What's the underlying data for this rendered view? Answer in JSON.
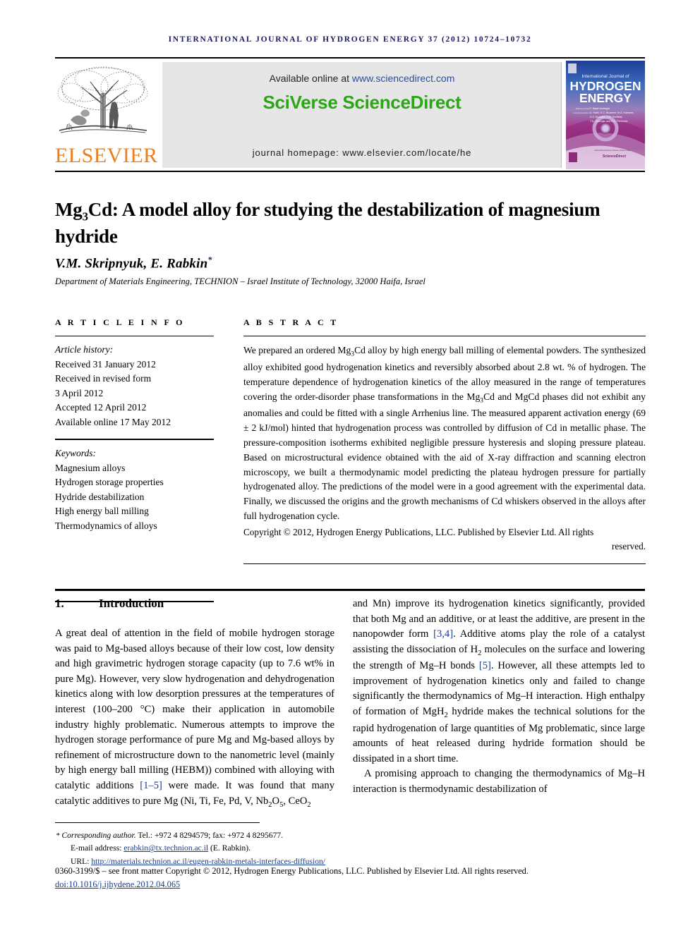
{
  "running_head": "International Journal of Hydrogen Energy 37 (2012) 10724–10732",
  "masthead": {
    "publisher_name": "ELSEVIER",
    "available_label": "Available online at ",
    "available_url": "www.sciencedirect.com",
    "sciencedirect_logo": "SciVerse ScienceDirect",
    "homepage": "journal homepage: www.elsevier.com/locate/he",
    "cover": {
      "line1": "International Journal of",
      "line2": "HYDROGEN",
      "line3": "ENERGY",
      "editor_label": "Editor-in-Chief",
      "editor_name": "T. Nejat Veziroglu",
      "assoc_label": "Associate Editors",
      "assoc_line1": "A. Hariri, E.C. Bruckner, M.A. Kaesche,",
      "assoc_line2": "N.Z. Muradov, J.W. Sheffield,",
      "assoc_line3": "T.N. Veziroglu and E.A. Pereseda",
      "indexed_label": "Indexed/Abstracted in Science Citation Index",
      "sd_badge": "ScienceDirect"
    }
  },
  "article": {
    "title_part1": "Mg",
    "title_sub": "3",
    "title_part2": "Cd: A model alloy for studying the destabilization of magnesium hydride",
    "authors": "V.M. Skripnyuk, E. Rabkin",
    "author_star": "*",
    "affiliation": "Department of Materials Engineering, TECHNION – Israel Institute of Technology, 32000 Haifa, Israel"
  },
  "info": {
    "heading": "A R T I C L E   I N F O",
    "history_label": "Article history:",
    "history": [
      "Received 31 January 2012",
      "Received in revised form",
      "3 April 2012",
      "Accepted 12 April 2012",
      "Available online 17 May 2012"
    ],
    "keywords_label": "Keywords:",
    "keywords": [
      "Magnesium alloys",
      "Hydrogen storage properties",
      "Hydride destabilization",
      "High energy ball milling",
      "Thermodynamics of alloys"
    ]
  },
  "abstract": {
    "heading": "A B S T R A C T",
    "text_a": "We prepared an ordered Mg",
    "text_a_sub": "3",
    "text_b": "Cd alloy by high energy ball milling of elemental powders. The synthesized alloy exhibited good hydrogenation kinetics and reversibly absorbed about 2.8 wt. % of hydrogen. The temperature dependence of hydrogenation kinetics of the alloy measured in the range of temperatures covering the order-disorder phase transformations in the Mg",
    "text_b_sub": "3",
    "text_c": "Cd and MgCd phases did not exhibit any anomalies and could be fitted with a single Arrhenius line. The measured apparent activation energy (69 ± 2 kJ/mol) hinted that hydrogenation process was controlled by diffusion of Cd in metallic phase. The pressure-composition isotherms exhibited negligible pressure hysteresis and sloping pressure plateau. Based on microstructural evidence obtained with the aid of X-ray diffraction and scanning electron microscopy, we built a thermodynamic model predicting the plateau hydrogen pressure for partially hydrogenated alloy. The predictions of the model were in a good agreement with the experimental data. Finally, we discussed the origins and the growth mechanisms of Cd whiskers observed in the alloys after full hydrogenation cycle.",
    "copyright_main": "Copyright © 2012, Hydrogen Energy Publications, LLC. Published by Elsevier Ltd. All rights",
    "copyright_last": "reserved."
  },
  "body": {
    "section_number": "1.",
    "section_title": "Introduction",
    "left_p1_a": "A great deal of attention in the field of mobile hydrogen storage was paid to Mg-based alloys because of their low cost, low density and high gravimetric hydrogen storage capacity (up to 7.6 wt% in pure Mg). However, very slow hydrogenation and dehydrogenation kinetics along with low desorption pressures at the temperatures of interest (100–200 °C) make their application in automobile industry highly problematic. Numerous attempts to improve the hydrogen storage performance of pure Mg and Mg-based alloys by refinement of microstructure down to the nanometric level (mainly by high energy ball milling (HEBM)) combined with alloying with catalytic additions ",
    "left_ref1": "[1–5]",
    "left_p1_b": " were made. It was found that many catalytic additives to pure Mg (Ni, Ti, Fe, Pd, V, Nb",
    "left_sub1": "2",
    "left_p1_c": "O",
    "left_sub2": "5",
    "left_p1_d": ", CeO",
    "left_sub3": "2",
    "right_p1_a": "and Mn) improve its hydrogenation kinetics significantly, provided that both Mg and an additive, or at least the additive, are present in the nanopowder form ",
    "right_ref1": "[3,4]",
    "right_p1_b": ". Additive atoms play the role of a catalyst assisting the dissociation of H",
    "right_sub1": "2",
    "right_p1_c": " molecules on the surface and lowering the strength of Mg–H bonds ",
    "right_ref2": "[5]",
    "right_p1_d": ". However, all these attempts led to improvement of hydrogenation kinetics only and failed to change significantly the thermodynamics of Mg–H interaction. High enthalpy of formation of MgH",
    "right_sub2": "2",
    "right_p1_e": " hydride makes the technical solutions for the rapid hydrogenation of large quantities of Mg problematic, since large amounts of heat released during hydride formation should be dissipated in a short time.",
    "right_p2": "A promising approach to changing the thermodynamics of Mg–H interaction is thermodynamic destabilization of"
  },
  "footer": {
    "star": "*",
    "corresponding_label": "Corresponding author.",
    "tel": " Tel.: +972 4 8294579; fax: +972 4 8295677.",
    "email_label": "E-mail address: ",
    "email": "erabkin@tx.technion.ac.il",
    "email_suffix": " (E. Rabkin).",
    "url_label": "URL: ",
    "url": "http://materials.technion.ac.il/eugen-rabkin-metals-interfaces-diffusion/",
    "issn_line": "0360-3199/$ – see front matter Copyright © 2012, Hydrogen Energy Publications, LLC. Published by Elsevier Ltd. All rights reserved.",
    "doi": "doi:10.1016/j.ijhydene.2012.04.065"
  }
}
